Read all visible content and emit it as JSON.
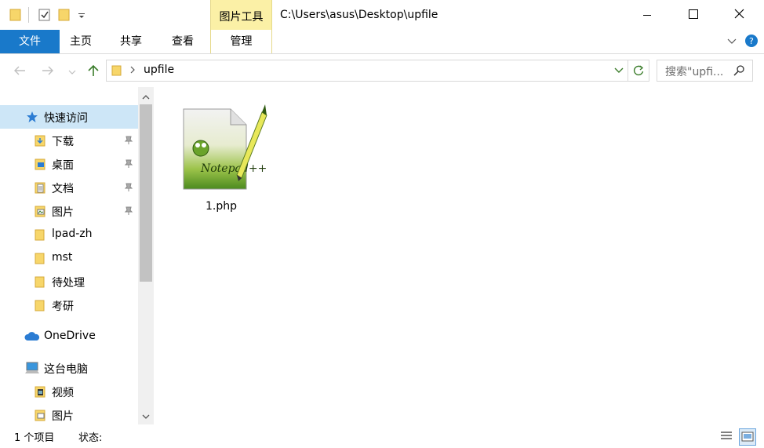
{
  "title_bar": {
    "tool_tab_label": "图片工具",
    "window_title": "C:\\Users\\asus\\Desktop\\upfile"
  },
  "ribbon": {
    "tabs": [
      {
        "label": "文件",
        "active": true
      },
      {
        "label": "主页"
      },
      {
        "label": "共享"
      },
      {
        "label": "查看"
      },
      {
        "label": "管理"
      }
    ]
  },
  "address_bar": {
    "path_segment": "upfile",
    "search_placeholder": "搜索\"upfi..."
  },
  "nav": {
    "items": [
      {
        "label": "快速访问",
        "icon": "star-icon"
      },
      {
        "label": "下载",
        "icon": "download-folder-icon",
        "pinned": true
      },
      {
        "label": "桌面",
        "icon": "desktop-folder-icon",
        "pinned": true
      },
      {
        "label": "文档",
        "icon": "documents-folder-icon",
        "pinned": true
      },
      {
        "label": "图片",
        "icon": "pictures-folder-icon",
        "pinned": true
      },
      {
        "label": "lpad-zh",
        "icon": "folder-icon"
      },
      {
        "label": "mst",
        "icon": "folder-icon"
      },
      {
        "label": "待处理",
        "icon": "folder-icon"
      },
      {
        "label": "考研",
        "icon": "folder-icon"
      },
      {
        "label": "OneDrive",
        "icon": "cloud-icon"
      },
      {
        "label": "这台电脑",
        "icon": "computer-icon"
      },
      {
        "label": "视频",
        "icon": "videos-folder-icon"
      },
      {
        "label": "图片",
        "icon": "pictures-folder-icon"
      }
    ]
  },
  "content": {
    "files": [
      {
        "name": "1.php",
        "icon": "notepad-plus-plus-file-icon"
      }
    ]
  },
  "status_bar": {
    "item_count": "1 个项目",
    "status_label": "状态:"
  },
  "colors": {
    "accent": "#1979ca",
    "tool_tab": "#fbf0a6",
    "selection": "#cde6f7"
  }
}
